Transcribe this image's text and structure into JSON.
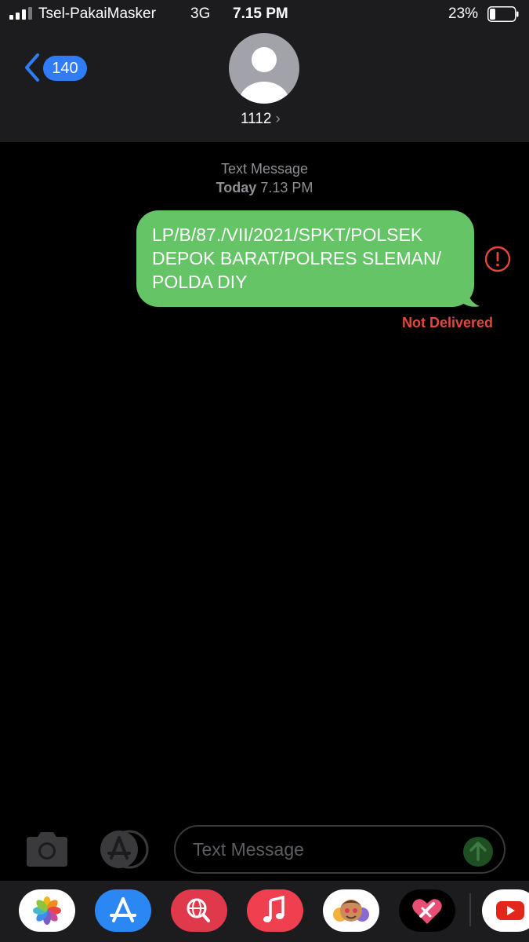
{
  "status_bar": {
    "carrier": "Tsel-PakaiMasker",
    "network": "3G",
    "time": "7.15 PM",
    "battery_percent": "23%",
    "battery_level": 0.23
  },
  "header": {
    "back_badge_count": "140",
    "contact_name": "1112",
    "contact_chevron": "›"
  },
  "thread": {
    "service_label": "Text Message",
    "date_bold": "Today",
    "date_time": " 7.13 PM",
    "messages": [
      {
        "direction": "outgoing",
        "lines": [
          "LP/B/87./VII/2021/SPKT/POLSEK",
          "DEPOK BARAT/POLRES SLEMAN/",
          "POLDA DIY"
        ],
        "status": "Not Delivered"
      }
    ]
  },
  "compose": {
    "placeholder": "Text Message"
  },
  "app_drawer": [
    {
      "name": "photos-app-icon"
    },
    {
      "name": "app-store-app-icon"
    },
    {
      "name": "search-images-app-icon"
    },
    {
      "name": "music-app-icon"
    },
    {
      "name": "memoji-stickers-app-icon"
    },
    {
      "name": "digital-touch-app-icon"
    },
    {
      "name": "youtube-app-icon"
    }
  ],
  "colors": {
    "header_bg": "#1c1c1e",
    "bubble_green": "#65c466",
    "error_red": "#e5473c",
    "badge_blue": "#2f7cf6"
  }
}
